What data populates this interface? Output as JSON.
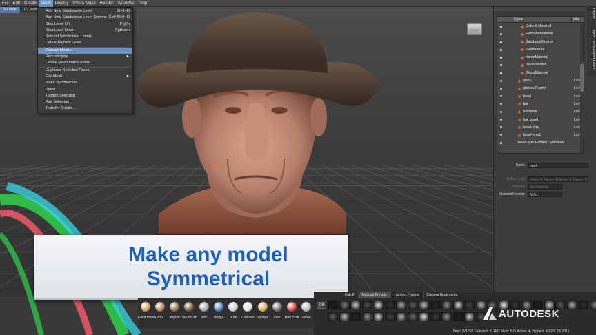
{
  "menubar": [
    "File",
    "Edit",
    "Create",
    "Mesh",
    "Display",
    "UVs & Maps",
    "Render",
    "Windows",
    "Help"
  ],
  "viewport_tabs": [
    "3D View",
    "UV View"
  ],
  "viewcube_label": "FRONT",
  "mesh_menu": [
    {
      "label": "Add New Subdivision Level",
      "shortcut": "Shift+D"
    },
    {
      "label": "Add New Subdivision Level Options",
      "shortcut": "Ctrl+Shift+D"
    },
    {
      "label": "Step Level Up",
      "shortcut": "PgUp"
    },
    {
      "label": "Step Level Down",
      "shortcut": "PgDown"
    },
    {
      "label": "Rebuild Subdivision Levels",
      "shortcut": ""
    },
    {
      "label": "Delete Highest Level",
      "shortcut": ""
    },
    {
      "label": "Reduce Mesh...",
      "shortcut": "",
      "highlighted": true
    },
    {
      "label": "Retopologize",
      "shortcut": "►"
    },
    {
      "label": "Create Mesh from Curves...",
      "shortcut": ""
    },
    {
      "label": "Duplicate Selected Faces",
      "shortcut": ""
    },
    {
      "label": "Flip Mesh",
      "shortcut": "►"
    },
    {
      "label": "Make Symmetrical...",
      "shortcut": ""
    },
    {
      "label": "Patch",
      "shortcut": ""
    },
    {
      "label": "Tighten Selection",
      "shortcut": ""
    },
    {
      "label": "Fair Selection",
      "shortcut": ""
    },
    {
      "label": "Transfer Details...",
      "shortcut": ""
    }
  ],
  "right_tabs": [
    "Layers",
    "Object List",
    "Viewport Filters"
  ],
  "layers": {
    "columns": [
      "Name",
      "Info"
    ],
    "rows": [
      {
        "name": "Default Material",
        "level": "",
        "type": "material"
      },
      {
        "name": "HatBandMaterial",
        "level": "",
        "type": "material"
      },
      {
        "name": "BandanaMaterial",
        "level": "",
        "type": "material"
      },
      {
        "name": "HatMaterial",
        "level": "",
        "type": "material"
      },
      {
        "name": "frameMaterial",
        "level": "",
        "type": "material"
      },
      {
        "name": "SkinMaterial",
        "level": "",
        "type": "material"
      },
      {
        "name": "GlassMaterial",
        "level": "",
        "type": "material"
      },
      {
        "name": "glass",
        "level": "Level",
        "type": "mesh"
      },
      {
        "name": "glassesFrame",
        "level": "Level",
        "type": "mesh"
      },
      {
        "name": "head",
        "level": "Level",
        "type": "mesh"
      },
      {
        "name": "hat",
        "level": "Level",
        "type": "mesh"
      },
      {
        "name": "bandana",
        "level": "Level",
        "type": "mesh"
      },
      {
        "name": "hat_band",
        "level": "Level",
        "type": "mesh"
      },
      {
        "name": "head-sym",
        "level": "Level",
        "type": "mesh"
      },
      {
        "name": "head-sym1",
        "level": "Level",
        "type": "mesh"
      },
      {
        "name": "head-sym Retopo Operation 1",
        "level": "",
        "type": "op"
      }
    ]
  },
  "properties": [
    {
      "label": "Name",
      "value": "head",
      "dim": false
    },
    {
      "label": "Active Level",
      "value": "(level: 4, Faces: 3) (level: 4, Faces: 13192)",
      "dim": true
    },
    {
      "label": "Material",
      "value": "SkinMaterial",
      "dim": true
    },
    {
      "label": "MaterialOverride",
      "value": "NULL",
      "dim": false
    }
  ],
  "banner": {
    "line1": "Make any model",
    "line2": "Symmetrical"
  },
  "tools": [
    {
      "label": "Paint Brush",
      "color": "#c9a25a"
    },
    {
      "label": "Wax",
      "color": "#b0825a"
    },
    {
      "label": "Imprint",
      "color": "#8e6f4e"
    },
    {
      "label": "Dry Brush",
      "color": "#7a5a3e"
    },
    {
      "label": "Blur",
      "color": "#9aa4ad"
    },
    {
      "label": "Dodge",
      "color": "#4d86c9"
    },
    {
      "label": "Burn",
      "color": "#cfcfcf"
    },
    {
      "label": "Contrast",
      "color": "#e0e0e0"
    },
    {
      "label": "Sponge",
      "color": "#d9a84a"
    },
    {
      "label": "Hue",
      "color": "#6f6f6f"
    },
    {
      "label": "Hue Shift",
      "color": "#d94a3a"
    },
    {
      "label": "Invert",
      "color": "#b8b8b8"
    }
  ],
  "preset_tabs": [
    "Falloff",
    "Material Presets",
    "Lighting Presets",
    "Camera Bookmarks"
  ],
  "off_label": "Off",
  "brand": "AUTODESK",
  "status": "Total: 224256  Selected: 0  GPU Mem: 595  Active: 4, Highest: 4  FPS: 26.0011"
}
